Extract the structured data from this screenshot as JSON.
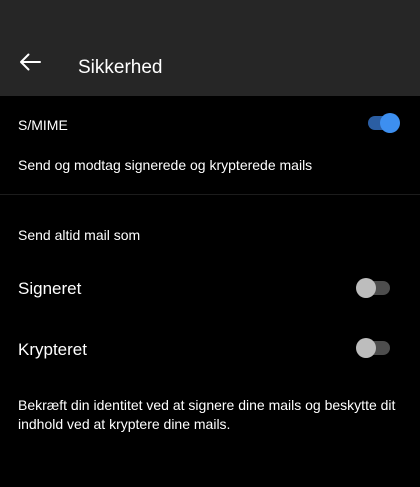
{
  "header": {
    "back_icon": "arrow-left-icon",
    "title": "Sikkerhed",
    "background": "#262626"
  },
  "smime": {
    "label": "S/MIME",
    "enabled": true,
    "description": "Send og modtag signerede og krypterede mails"
  },
  "always_send": {
    "heading": "Send altid mail som",
    "signed": {
      "label": "Signeret",
      "enabled": false
    },
    "encrypted": {
      "label": "Krypteret",
      "enabled": false
    },
    "note": "Bekræft din identitet ved at signere dine mails og beskytte dit indhold ved at kryptere dine mails."
  },
  "colors": {
    "toggle_on": "#3d8ff0",
    "toggle_off": "#bdbdbd",
    "background": "#000000"
  }
}
